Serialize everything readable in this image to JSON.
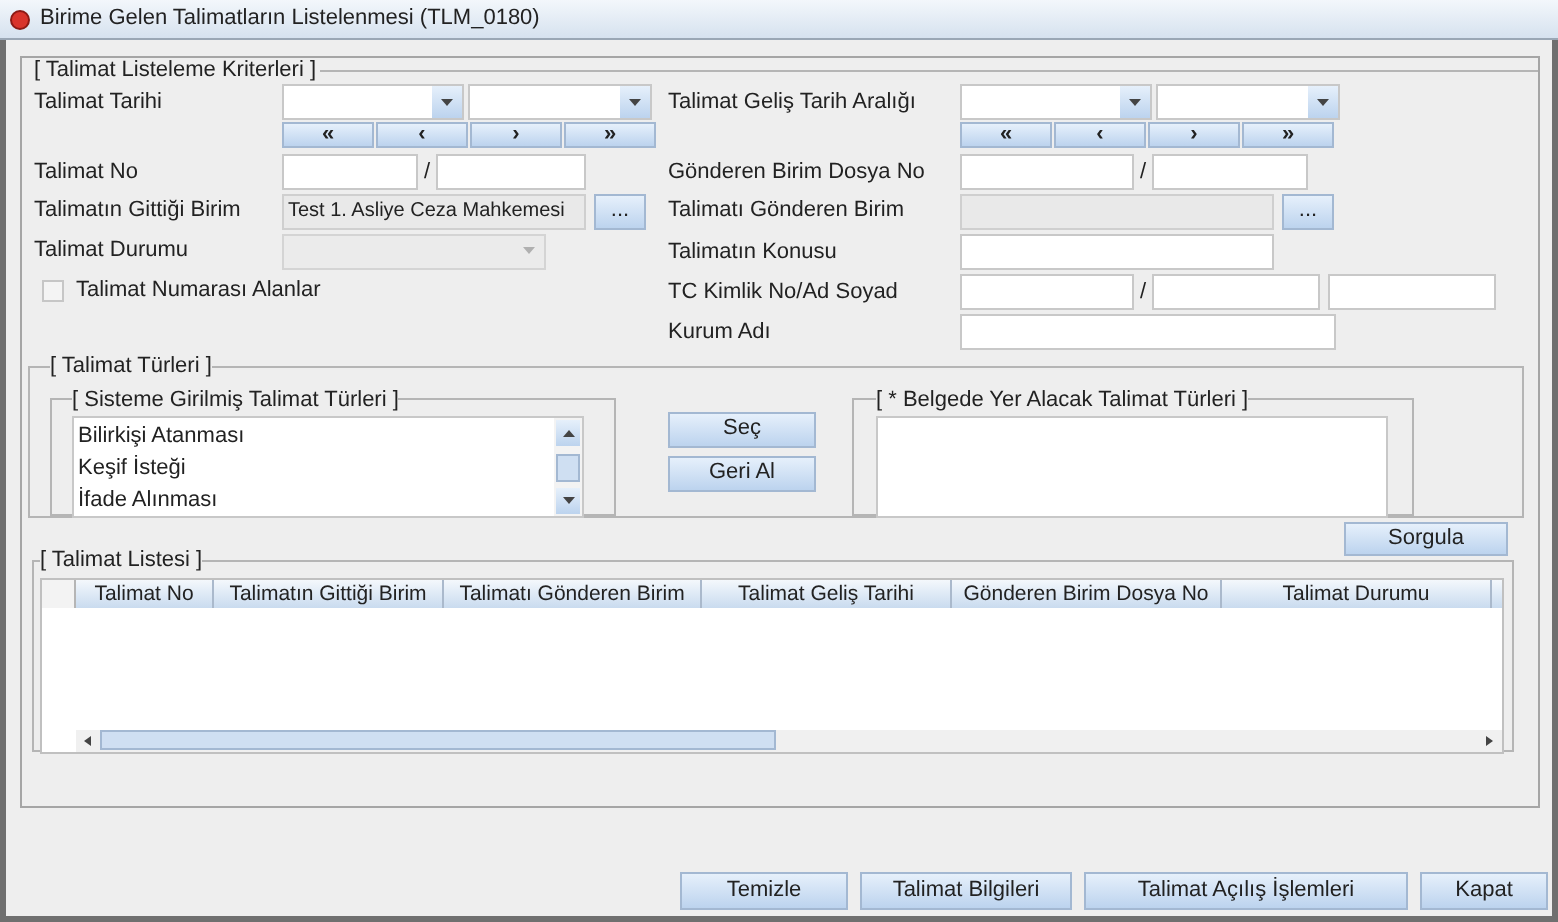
{
  "window": {
    "title": "Birime Gelen Talimatların Listelenmesi (TLM_0180)"
  },
  "criteria": {
    "legend": "[ Talimat Listeleme Kriterleri ]",
    "left": [
      {
        "kind": "date_range",
        "label": "Talimat Tarihi",
        "nav": [
          "«",
          "‹",
          "›",
          "»"
        ]
      },
      {
        "kind": "split",
        "label": "Talimat No",
        "separator": "/"
      },
      {
        "kind": "picker",
        "label": "Talimatın Gittiği Birim",
        "value": "Test 1. Asliye Ceza Mahkemesi",
        "button": "..."
      },
      {
        "kind": "combo",
        "label": "Talimat Durumu",
        "disabled": true
      }
    ],
    "checkbox": {
      "label": "Talimat Numarası Alanlar",
      "checked": false
    },
    "right": [
      {
        "kind": "date_range",
        "label": "Talimat Geliş Tarih Aralığı",
        "nav": [
          "«",
          "‹",
          "›",
          "»"
        ]
      },
      {
        "kind": "split",
        "label": "Gönderen Birim Dosya No",
        "separator": "/"
      },
      {
        "kind": "picker",
        "label": "Talimatı Gönderen Birim",
        "button": "..."
      },
      {
        "kind": "text",
        "label": "Talimatın Konusu"
      },
      {
        "kind": "triple",
        "label": "TC Kimlik No/Ad Soyad",
        "separator": "/"
      },
      {
        "kind": "text",
        "label": "Kurum Adı"
      }
    ]
  },
  "types": {
    "legend": "[ Talimat Türleri ]",
    "available": {
      "legend": "[ Sisteme Girilmiş Talimat Türleri ]",
      "items": [
        "Bilirkişi Atanması",
        "Keşif İsteği",
        "İfade Alınması"
      ]
    },
    "buttons": [
      "Seç",
      "Geri Al"
    ],
    "chosen": {
      "legend": "[ * Belgede Yer Alacak Talimat Türleri ]"
    }
  },
  "query_button": "Sorgula",
  "list": {
    "legend": "[ Talimat Listesi ]",
    "columns": [
      "Talimat No",
      "Talimatın Gittiği Birim",
      "Talimatı Gönderen Birim",
      "Talimat Geliş Tarihi",
      "Gönderen Birim Dosya No",
      "Talimat Durumu"
    ]
  },
  "footer_buttons": [
    "Temizle",
    "Talimat Bilgileri",
    "Talimat Açılış İşlemleri",
    "Kapat"
  ]
}
